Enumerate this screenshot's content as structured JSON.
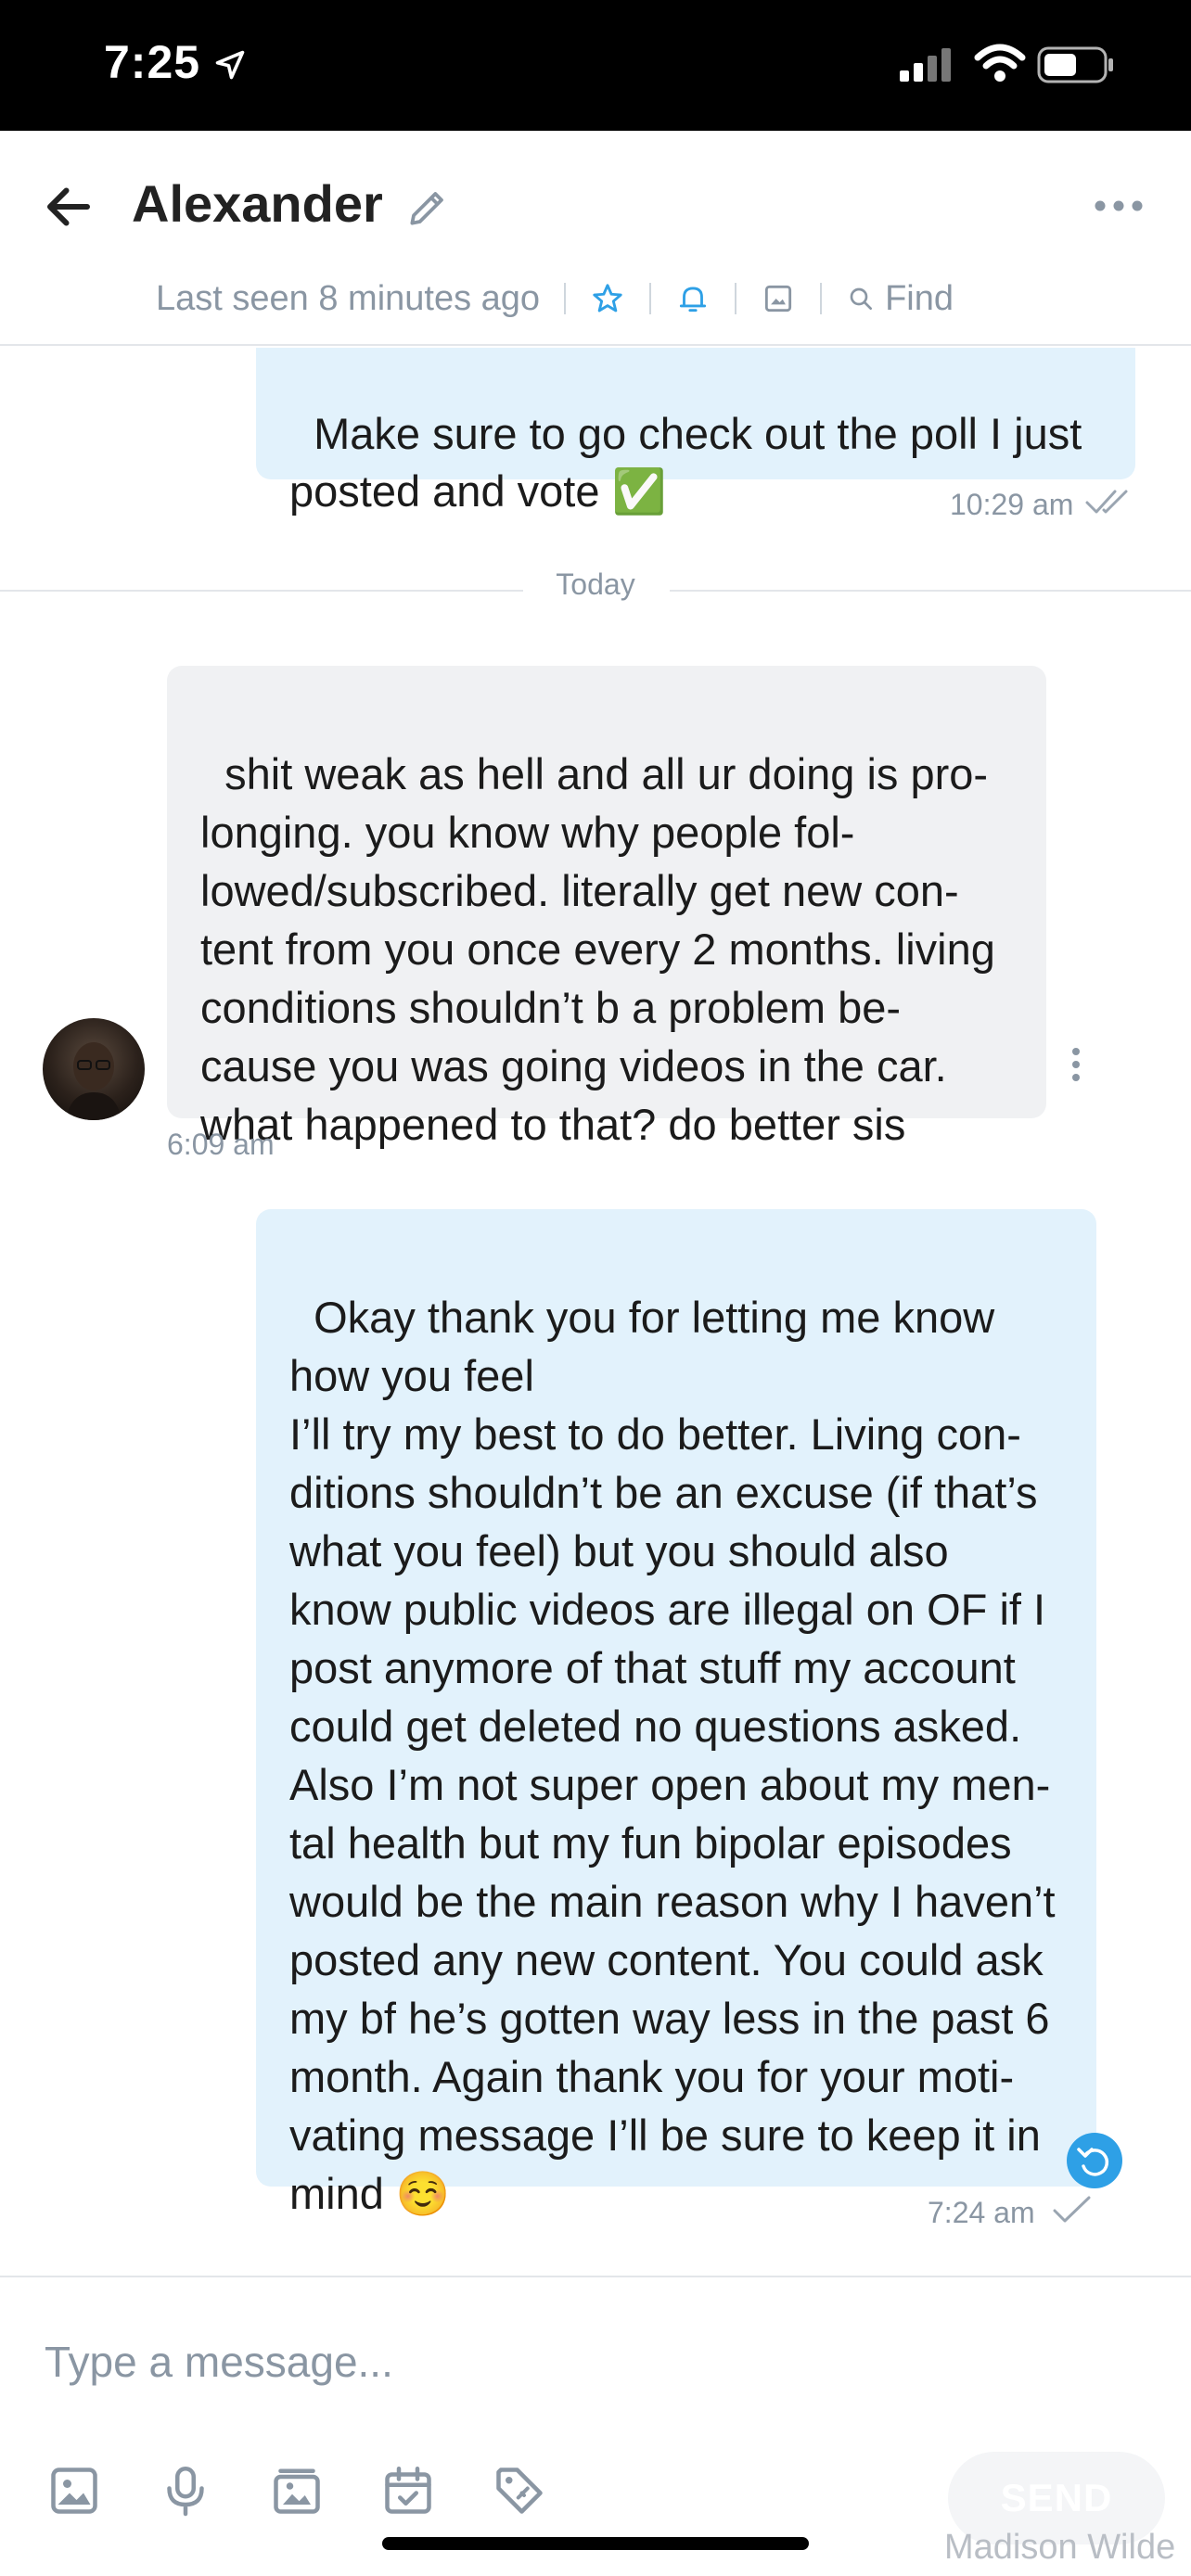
{
  "status_bar": {
    "time": "7:25"
  },
  "header": {
    "contact_name": "Alexander",
    "last_seen": "Last seen 8 minutes ago",
    "find_label": "Find"
  },
  "messages": [
    {
      "direction": "outgoing",
      "text": "Make sure to go check out the poll I just\nposted and vote ✅",
      "time": "10:29 am",
      "status": "read"
    },
    {
      "type": "divider",
      "label": "Today"
    },
    {
      "direction": "incoming",
      "text": "shit weak as hell and all ur doing is pro-\nlonging. you know why people fol-\nlowed/subscribed. literally get new con-\ntent from you once every 2 months. living\nconditions shouldn’t b a problem be-\ncause you was going videos in the car.\nwhat happened to that? do better sis",
      "time": "6:09 am"
    },
    {
      "direction": "outgoing",
      "text": "Okay thank you for letting me know\nhow you feel\nI’ll try my best to do better. Living con-\nditions shouldn’t be an excuse (if that’s\nwhat you feel) but you should also\nknow public videos are illegal on OF if I\npost anymore of that stuff my account\ncould get deleted no questions asked.\nAlso I’m not super open about my men-\ntal health but my fun bipolar episodes\nwould be the main reason why I haven’t\nposted any new content. You could ask\nmy bf he’s gotten way less in the past 6\nmonth. Again thank you for your moti-\nvating message I’ll be sure to keep it in\nmind ☺️",
      "time": "7:24 am",
      "status": "sent"
    }
  ],
  "composer": {
    "placeholder": "Type a message...",
    "send_label": "SEND",
    "tools": [
      "image-icon",
      "microphone-icon",
      "media-vault-icon",
      "calendar-icon",
      "price-tag-icon"
    ]
  },
  "watermark": "Madison Wilde",
  "colors": {
    "accent": "#2ea0e6",
    "outgoing_bubble": "#e2f2fc",
    "incoming_bubble": "#f0f1f3",
    "muted_text": "#8a96a3"
  }
}
